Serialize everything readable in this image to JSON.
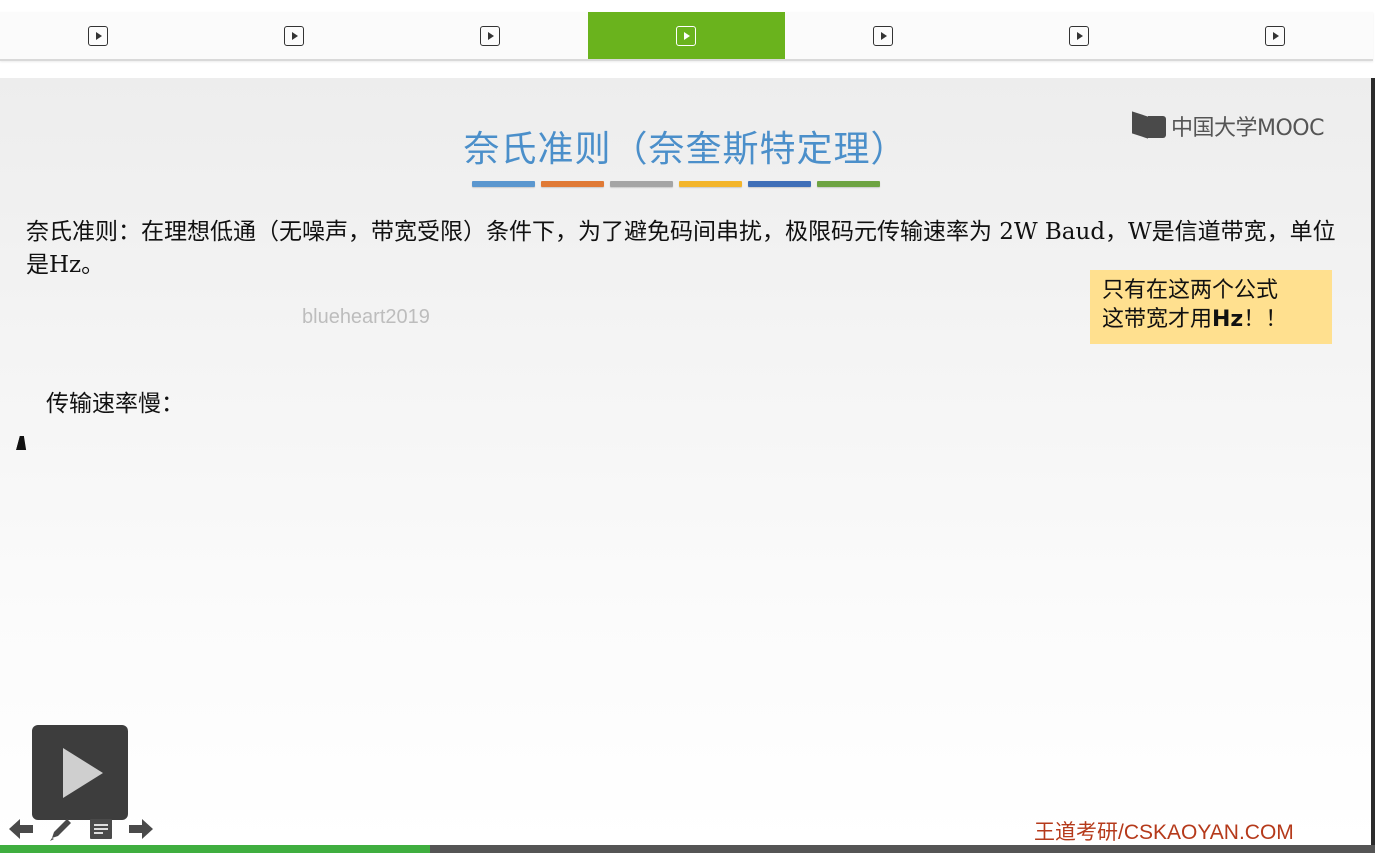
{
  "tabs": [
    {
      "icon": "play-icon",
      "active": false
    },
    {
      "icon": "play-icon",
      "active": false
    },
    {
      "icon": "play-icon",
      "active": false
    },
    {
      "icon": "play-icon",
      "active": true
    },
    {
      "icon": "play-icon",
      "active": false
    },
    {
      "icon": "play-icon",
      "active": false
    },
    {
      "icon": "play-icon",
      "active": false
    }
  ],
  "slide": {
    "title": "奈氏准则（奈奎斯特定理）",
    "logo_text": "中国大学MOOC",
    "color_bars": [
      "#5b97cf",
      "#e07a36",
      "#a5a5a5",
      "#f3b52b",
      "#3f6fb8",
      "#6ea443"
    ],
    "body_text": "奈氏准则：在理想低通（无噪声，带宽受限）条件下，为了避免码间串扰，极限码元传输速率为 2W Baud，W是信道带宽，单位是Hz。",
    "note": {
      "line1": "只有在这两个公式",
      "line2_prefix": "这带宽才用",
      "line2_bold": "Hz",
      "line2_suffix": "！！"
    },
    "watermark": "blueheart2019",
    "subheading": "传输速率慢：",
    "footer_brand": "王道考研/CSKAOYAN.COM"
  },
  "player": {
    "progress": 0.313,
    "controls": [
      "prev-arrow-icon",
      "pen-icon",
      "notes-icon",
      "next-arrow-icon"
    ]
  },
  "colors": {
    "active_tab": "#6ab31d",
    "title": "#4b8fca",
    "note_bg": "#ffe08f",
    "brand": "#b53a1b",
    "progress": "#3fae3f"
  }
}
